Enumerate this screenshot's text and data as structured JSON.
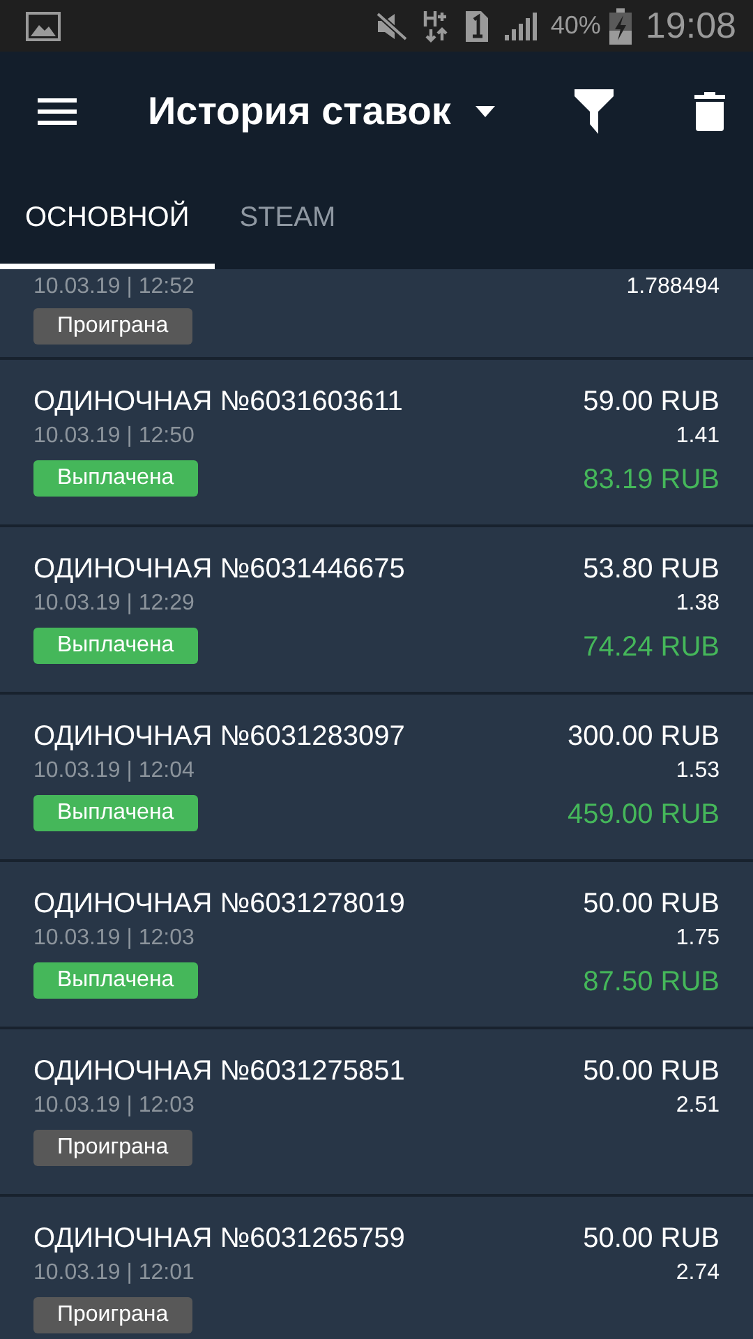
{
  "status_bar": {
    "battery": "40%",
    "time": "19:08"
  },
  "app_bar": {
    "title": "История ставок"
  },
  "tabs": [
    {
      "label": "ОСНОВНОЙ",
      "selected": true
    },
    {
      "label": "STEAM",
      "selected": false
    }
  ],
  "bets": [
    {
      "kind": "lost",
      "date": "10.03.19 | 12:52",
      "odds": "1.788494",
      "status": "Проиграна"
    },
    {
      "kind": "won",
      "title": "ОДИНОЧНАЯ №6031603611",
      "date": "10.03.19 | 12:50",
      "stake": "59.00 RUB",
      "odds": "1.41",
      "status": "Выплачена",
      "payout": "83.19 RUB"
    },
    {
      "kind": "won",
      "title": "ОДИНОЧНАЯ №6031446675",
      "date": "10.03.19 | 12:29",
      "stake": "53.80 RUB",
      "odds": "1.38",
      "status": "Выплачена",
      "payout": "74.24 RUB"
    },
    {
      "kind": "won",
      "title": "ОДИНОЧНАЯ №6031283097",
      "date": "10.03.19 | 12:04",
      "stake": "300.00 RUB",
      "odds": "1.53",
      "status": "Выплачена",
      "payout": "459.00 RUB"
    },
    {
      "kind": "won",
      "title": "ОДИНОЧНАЯ №6031278019",
      "date": "10.03.19 | 12:03",
      "stake": "50.00 RUB",
      "odds": "1.75",
      "status": "Выплачена",
      "payout": "87.50 RUB"
    },
    {
      "kind": "lost",
      "title": "ОДИНОЧНАЯ №6031275851",
      "date": "10.03.19 | 12:03",
      "stake": "50.00 RUB",
      "odds": "2.51",
      "status": "Проиграна"
    },
    {
      "kind": "lost",
      "title": "ОДИНОЧНАЯ №6031265759",
      "date": "10.03.19 | 12:01",
      "stake": "50.00 RUB",
      "odds": "2.74",
      "status": "Проиграна"
    }
  ]
}
